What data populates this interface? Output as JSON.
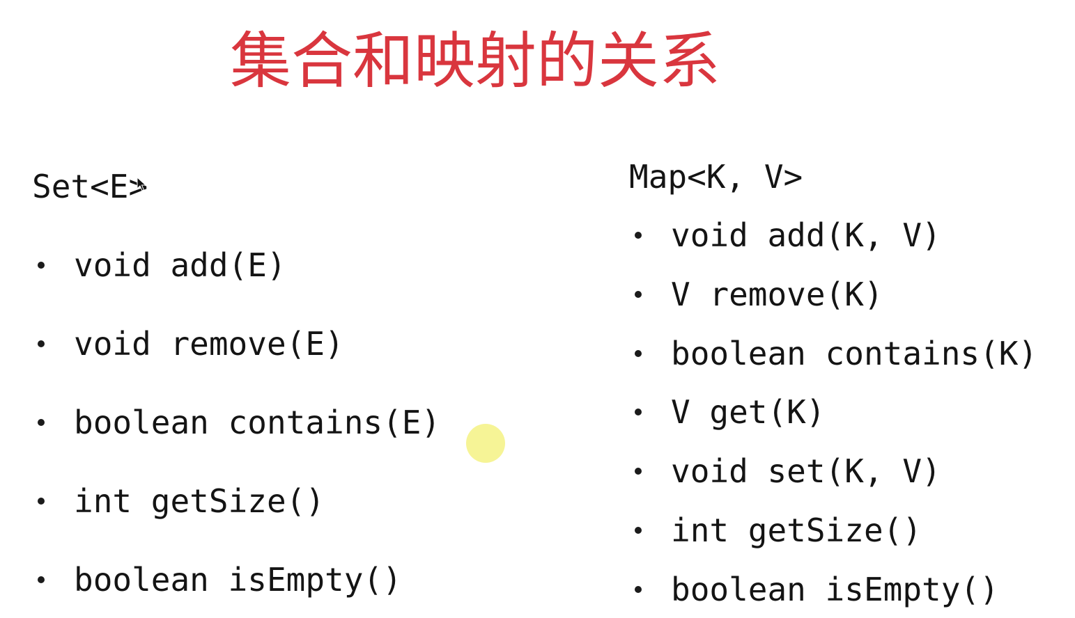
{
  "title": "集合和映射的关系",
  "colors": {
    "title": "#d9363e",
    "text": "#141414",
    "cursor_highlight": "#f6f496"
  },
  "set_column": {
    "heading": "Set<E>",
    "items": [
      "void add(E)",
      "void remove(E)",
      "boolean contains(E)",
      "int getSize()",
      "boolean isEmpty()"
    ]
  },
  "map_column": {
    "heading": "Map<K, V>",
    "items": [
      "void add(K, V)",
      "V remove(K)",
      "boolean contains(K)",
      "V get(K)",
      "void set(K, V)",
      "int getSize()",
      "boolean isEmpty()"
    ]
  },
  "icons": {
    "pointer": "mouse-pointer-icon",
    "highlight": "cursor-highlight-icon"
  }
}
